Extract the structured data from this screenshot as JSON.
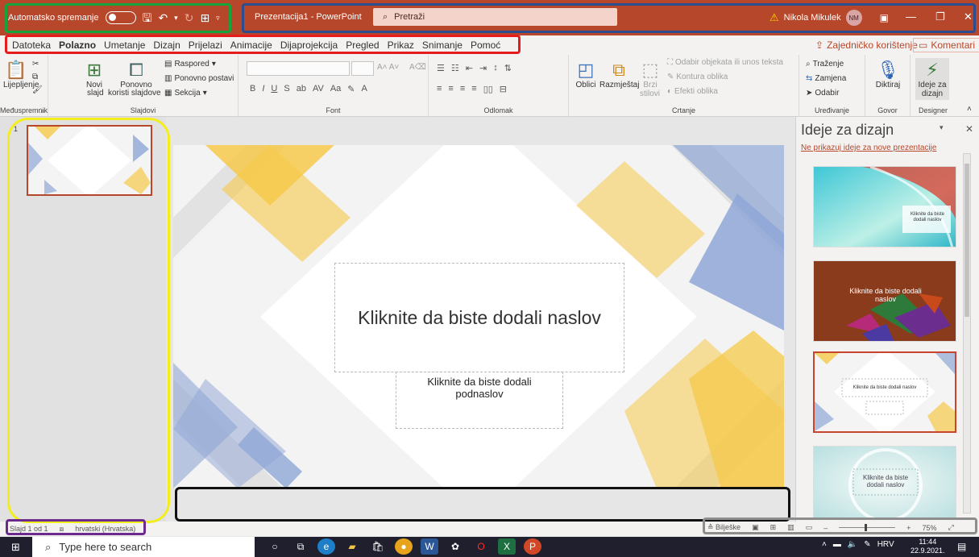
{
  "titlebar": {
    "autosave_label": "Automatsko spremanje",
    "title": "Prezentacija1 - PowerPoint",
    "search_placeholder": "Pretraži",
    "user_name": "Nikola Mikulek",
    "user_initials": "NM"
  },
  "menu": {
    "tabs": [
      "Datoteka",
      "Polazno",
      "Umetanje",
      "Dizajn",
      "Prijelazi",
      "Animacije",
      "Dijaprojekcija",
      "Pregled",
      "Prikaz",
      "Snimanje",
      "Pomoć"
    ],
    "share": "Zajedničko korištenje",
    "comments": "Komentari"
  },
  "ribbon": {
    "clipboard": {
      "paste": "Lijepljenje",
      "group": "Međuspremnik"
    },
    "slides": {
      "new_line1": "Novi",
      "new_line2": "slajd",
      "reuse_line1": "Ponovno",
      "reuse_line2": "koristi slajdove",
      "layout": "Raspored",
      "reset": "Ponovno postavi",
      "section": "Sekcija",
      "group": "Slajdovi"
    },
    "font": {
      "group": "Font"
    },
    "paragraph": {
      "group": "Odlomak"
    },
    "drawing": {
      "shapes": "Oblici",
      "arrange": "Razmještaj",
      "quick_styles_line1": "Brzi",
      "quick_styles_line2": "stilovi",
      "select_objects": "Odabir objekata ili unos teksta",
      "shape_outline": "Kontura oblika",
      "shape_effects": "Efekti oblika",
      "group": "Crtanje"
    },
    "editing": {
      "find": "Traženje",
      "replace": "Zamjena",
      "select": "Odabir",
      "group": "Uređivanje"
    },
    "voice": {
      "dictate": "Diktiraj",
      "group": "Govor"
    },
    "designer": {
      "ideas_line1": "Ideje za",
      "ideas_line2": "dizajn",
      "group": "Designer"
    }
  },
  "slide_panel": {
    "slide_number": "1"
  },
  "slide": {
    "title_placeholder": "Kliknite da biste dodali naslov",
    "subtitle_line1": "Kliknite da biste dodali",
    "subtitle_line2": "podnaslov"
  },
  "designer_pane": {
    "title": "Ideje za dizajn",
    "dont_show": "Ne prikazuj ideje za nove prezentacije",
    "thumb1_line1": "Kliknite da biste",
    "thumb1_line2": "dodali naslov",
    "thumb2_line1": "Kliknite da biste dodali",
    "thumb2_line2": "naslov",
    "thumb3_title": "Kliknite da biste dodali naslov",
    "thumb4_line1": "Kliknite da biste",
    "thumb4_line2": "dodali naslov"
  },
  "statusbar": {
    "slide_info": "Slajd 1 od 1",
    "language": "hrvatski (Hrvatska)",
    "notes": "Bilješke",
    "zoom": "75%"
  },
  "taskbar": {
    "search_placeholder": "Type here to search",
    "language": "HRV",
    "time": "11:44",
    "date": "22.9.2021."
  },
  "colors": {
    "accent": "#b7472a",
    "yellow_shape": "#f6c94a",
    "blue_shape": "#8fa6d6",
    "frame_green": "#16a33c",
    "frame_blue": "#2b4d8f",
    "frame_red": "#e51c1c",
    "frame_yellow": "#f3ee1b",
    "frame_purple": "#6c2a8f",
    "frame_black": "#111111",
    "frame_grey": "#8d8d8d"
  }
}
